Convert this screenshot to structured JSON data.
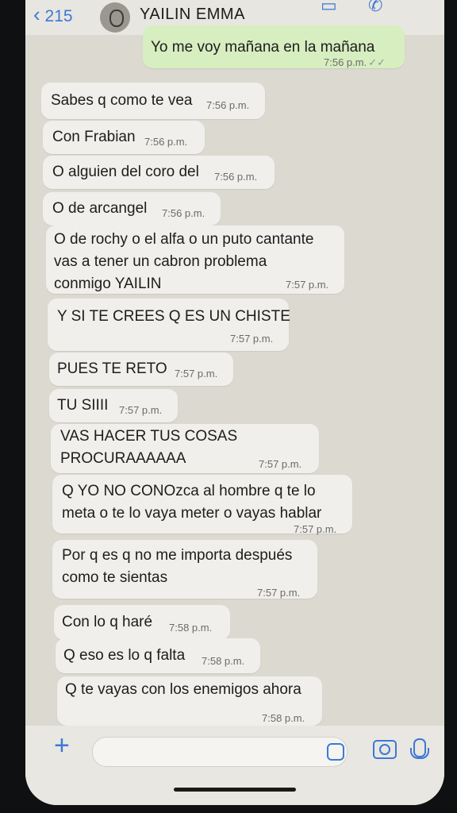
{
  "header": {
    "back_count": "215",
    "contact_name": "YAILIN EMMA",
    "video_icon": "video-call-icon",
    "phone_icon": "phone-call-icon"
  },
  "messages": [
    {
      "dir": "out",
      "text": "Yo me voy mañana en la mañana",
      "time": "7:56 p.m.",
      "status": "read-ticks"
    },
    {
      "dir": "in",
      "text": "Sabes q como te vea",
      "time": "7:56 p.m."
    },
    {
      "dir": "in",
      "text": "Con Frabian",
      "time": "7:56 p.m."
    },
    {
      "dir": "in",
      "text": "O alguien del coro del",
      "time": "7:56 p.m."
    },
    {
      "dir": "in",
      "text": "O de arcangel",
      "time": "7:56 p.m."
    },
    {
      "dir": "in",
      "text": "O de rochy o el alfa o un puto cantante\nvas a tener un cabron problema\nconmigo YAILIN",
      "time": "7:57 p.m."
    },
    {
      "dir": "in",
      "text": "Y SI TE CREES Q ES UN CHISTE",
      "time": "7:57 p.m."
    },
    {
      "dir": "in",
      "text": "PUES TE RETO",
      "time": "7:57 p.m."
    },
    {
      "dir": "in",
      "text": "TU SIIII",
      "time": "7:57 p.m."
    },
    {
      "dir": "in",
      "text": "VAS HACER TUS COSAS\nPROCURAAAAAA",
      "time": "7:57 p.m."
    },
    {
      "dir": "in",
      "text": "Q YO NO CONOzca al hombre q te lo\nmeta o te lo vaya meter o vayas hablar",
      "time": "7:57 p.m."
    },
    {
      "dir": "in",
      "text": "Por q es q no me importa después\ncomo te sientas",
      "time": "7:57 p.m."
    },
    {
      "dir": "in",
      "text": "Con lo q haré",
      "time": "7:58 p.m."
    },
    {
      "dir": "in",
      "text": "Q eso es lo q falta",
      "time": "7:58 p.m."
    },
    {
      "dir": "in",
      "text": "Q te vayas con los enemigos ahora",
      "time": "7:58 p.m."
    }
  ],
  "input": {
    "plus_icon": "plus-icon",
    "sticker_icon": "sticker-icon",
    "camera_icon": "camera-icon",
    "mic_icon": "microphone-icon"
  }
}
